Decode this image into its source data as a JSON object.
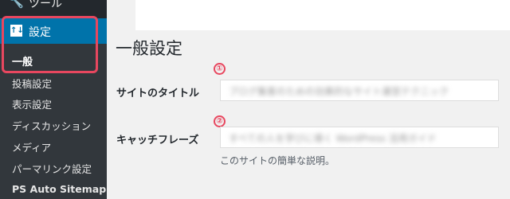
{
  "sidebar": {
    "tools_label": "ツール",
    "settings_label": "設定",
    "settings_icon_text": "↑↓",
    "submenu": [
      "一般",
      "投稿設定",
      "表示設定",
      "ディスカッション",
      "メディア",
      "パーマリンク設定",
      "PS Auto Sitemap"
    ]
  },
  "main": {
    "title": "一般設定",
    "site_title": {
      "label": "サイトのタイトル",
      "marker": "①",
      "value": "ブログ集客のための効果的なサイト運営テクニック"
    },
    "tagline": {
      "label": "キャッチフレーズ",
      "marker": "②",
      "value": "すべての人を学びに導く WordPress 活用ガイド"
    },
    "tagline_description": "このサイトの簡単な説明。"
  },
  "colors": {
    "menu_bg": "#23282d",
    "submenu_bg": "#32373c",
    "active_bg": "#0073aa",
    "annotation": "#e8475f"
  }
}
